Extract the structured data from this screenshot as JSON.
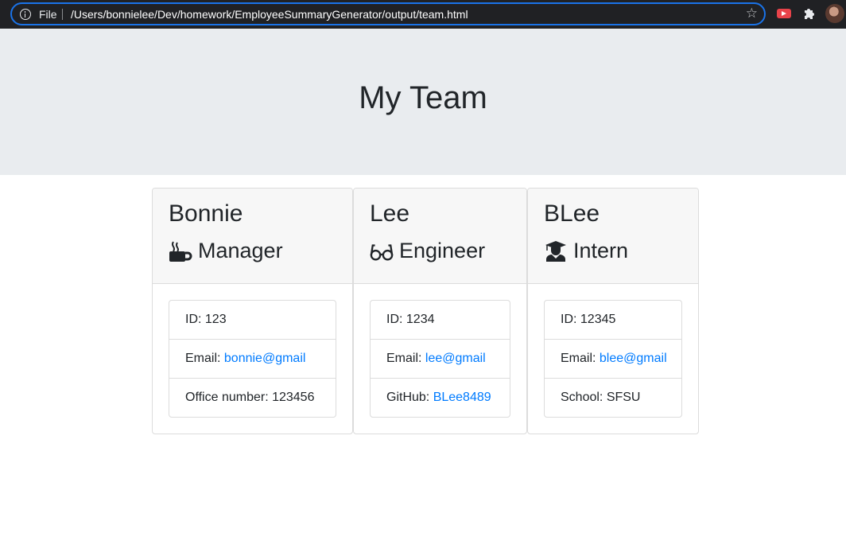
{
  "browser": {
    "scheme_label": "File",
    "url": "/Users/bonnielee/Dev/homework/EmployeeSummaryGenerator/output/team.html",
    "star_icon": "☆"
  },
  "header": {
    "title": "My Team"
  },
  "employees": [
    {
      "name": "Bonnie",
      "role": "Manager",
      "role_icon": "coffee-mug-icon",
      "id_label": "ID: 123",
      "email_label": "Email: ",
      "email": "bonnie@gmail",
      "extra_label": "Office number: 123456"
    },
    {
      "name": "Lee",
      "role": "Engineer",
      "role_icon": "glasses-icon",
      "id_label": "ID: 1234",
      "email_label": "Email: ",
      "email": "lee@gmail",
      "extra_label": "GitHub: ",
      "extra_link": "BLee8489"
    },
    {
      "name": "BLee",
      "role": "Intern",
      "role_icon": "graduate-icon",
      "id_label": "ID: 12345",
      "email_label": "Email: ",
      "email": "blee@gmail",
      "extra_label": "School: SFSU"
    }
  ],
  "colors": {
    "jumbotron_bg": "#e9ecef",
    "link": "#007bff",
    "card_header_bg": "#f7f7f7",
    "chrome_bg": "#202124",
    "focus_ring": "#1a73e8"
  }
}
